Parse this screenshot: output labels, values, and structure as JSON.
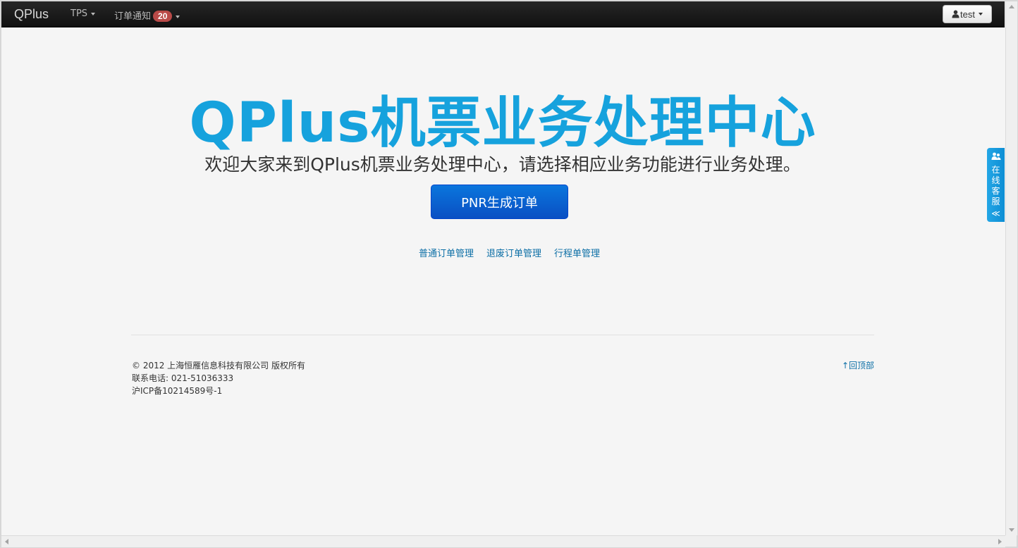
{
  "navbar": {
    "brand": "QPlus",
    "tps_label": "TPS",
    "orders_label": "订单通知",
    "orders_badge": "20",
    "user_label": "test"
  },
  "hero": {
    "title": "QPlus机票业务处理中心",
    "subtitle": "欢迎大家来到QPlus机票业务处理中心，请选择相应业务功能进行业务处理。",
    "pnr_button": "PNR生成订单"
  },
  "links": [
    {
      "label": "普通订单管理"
    },
    {
      "label": "退废订单管理"
    },
    {
      "label": "行程单管理"
    }
  ],
  "footer": {
    "copyright": "© 2012 上海恒雁信息科技有限公司 版权所有",
    "phone": "联系电话: 021-51036333",
    "icp": "沪ICP备10214589号-1",
    "back_to_top": "↑回顶部"
  },
  "online_service": {
    "label": "在线客服",
    "chevron": "≪"
  },
  "colors": {
    "navbar_bg": "#1b1b1b",
    "title": "#16a2dd",
    "button": "#0a5fd0",
    "link": "#0d6fa6",
    "badge": "#b94a48",
    "service_tab": "#1a9be0"
  },
  "icons": {
    "user": "user-icon",
    "service": "people-icon"
  }
}
